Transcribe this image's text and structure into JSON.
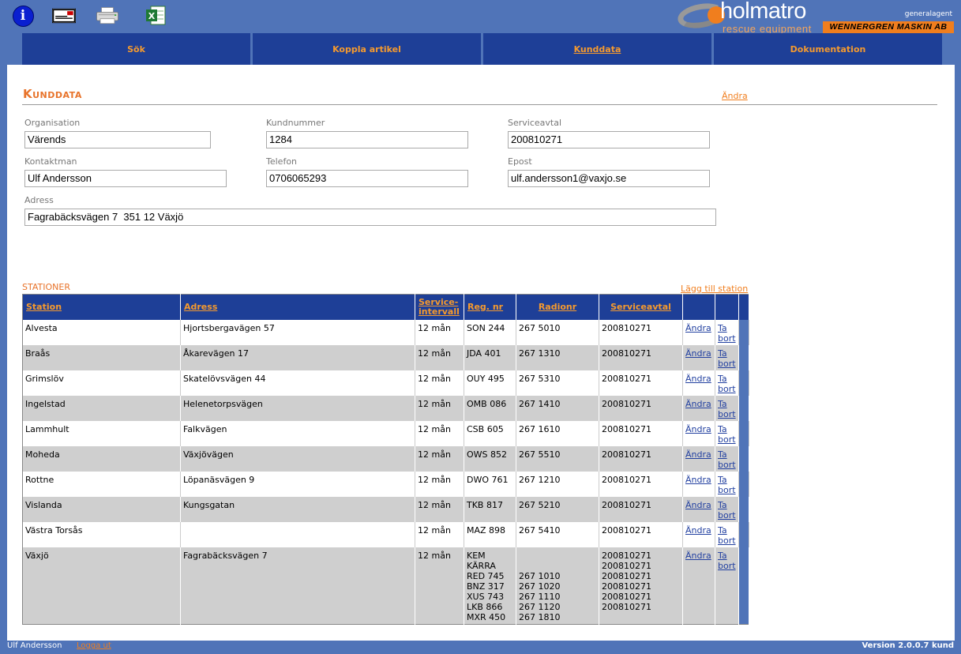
{
  "toolbar": {
    "icons": [
      "info-icon",
      "document-icon",
      "printer-icon",
      "excel-icon"
    ],
    "info_glyph": "i"
  },
  "logo": {
    "name": "holmatro",
    "tagline": "rescue equipment",
    "agent_label": "generalagent",
    "dealer": "WENNERGREN MASKIN AB"
  },
  "colors": {
    "background": "#5074b8",
    "nav": "#1e3f97",
    "accent": "#f07e1e",
    "row_alt": "#cfcfcf"
  },
  "nav": {
    "tabs": [
      {
        "label": "Sök"
      },
      {
        "label": "Koppla artikel"
      },
      {
        "label": "Kunddata"
      },
      {
        "label": "Dokumentation"
      }
    ],
    "active": "Kunddata"
  },
  "customer": {
    "title": "Kunddata",
    "edit_label": "Ändra",
    "fields": {
      "organisation": {
        "label": "Organisation",
        "value": "Värends"
      },
      "kundnummer": {
        "label": "Kundnummer",
        "value": "1284"
      },
      "serviceavtal": {
        "label": "Serviceavtal",
        "value": "200810271"
      },
      "kontaktman": {
        "label": "Kontaktman",
        "value": "Ulf Andersson"
      },
      "telefon": {
        "label": "Telefon",
        "value": "0706065293"
      },
      "epost": {
        "label": "Epost",
        "value": "ulf.andersson1@vaxjo.se"
      },
      "adress": {
        "label": "Adress",
        "value": "Fagrabäcksvägen 7  351 12 Växjö"
      }
    }
  },
  "stations": {
    "title": "STATIONER",
    "add_label": "Lägg till station",
    "edit_label": "Ändra",
    "delete_label": "Ta bort",
    "columns": [
      "Station",
      "Adress",
      "Service-intervall",
      "Reg. nr",
      "Radionr",
      "Serviceavtal"
    ],
    "rows": [
      {
        "station": "Alvesta",
        "adress": "Hjortsbergavägen 57",
        "intervall": "12 mån",
        "regnr": "SON 244",
        "radionr": "267 5010",
        "avtal": "200810271"
      },
      {
        "station": "Braås",
        "adress": "Åkarevägen 17",
        "intervall": "12 mån",
        "regnr": "JDA 401",
        "radionr": "267 1310",
        "avtal": "200810271"
      },
      {
        "station": "Grimslöv",
        "adress": "Skatelövsvägen 44",
        "intervall": "12 mån",
        "regnr": "OUY 495",
        "radionr": "267 5310",
        "avtal": "200810271"
      },
      {
        "station": "Ingelstad",
        "adress": "Helenetorpsvägen",
        "intervall": "12 mån",
        "regnr": "OMB 086",
        "radionr": "267 1410",
        "avtal": "200810271"
      },
      {
        "station": "Lammhult",
        "adress": "Falkvägen",
        "intervall": "12 mån",
        "regnr": "CSB 605",
        "radionr": "267 1610",
        "avtal": "200810271"
      },
      {
        "station": "Moheda",
        "adress": "Växjövägen",
        "intervall": "12 mån",
        "regnr": "OWS 852",
        "radionr": "267 5510",
        "avtal": "200810271"
      },
      {
        "station": "Rottne",
        "adress": "Löpanäsvägen 9",
        "intervall": "12 mån",
        "regnr": "DWO 761",
        "radionr": "267 1210",
        "avtal": "200810271"
      },
      {
        "station": "Vislanda",
        "adress": "Kungsgatan",
        "intervall": "12 mån",
        "regnr": "TKB 817",
        "radionr": "267 5210",
        "avtal": "200810271"
      },
      {
        "station": "Västra Torsås",
        "adress": "",
        "intervall": "12 mån",
        "regnr": "MAZ 898",
        "radionr": "267 5410",
        "avtal": "200810271"
      }
    ],
    "last_row": {
      "station": "Växjö",
      "adress": "Fagrabäcksvägen 7",
      "intervall": "12 mån",
      "regnr": [
        "KEM",
        "KÄRRA",
        "RED 745",
        "BNZ 317",
        "XUS 743",
        "LKB 866",
        "MXR 450"
      ],
      "radionr": [
        "",
        "",
        "267 1010",
        "267 1020",
        "267 1110",
        "267 1120",
        "267 1810"
      ],
      "avtal": [
        "200810271",
        "200810271",
        "200810271",
        "200810271",
        "200810271",
        "200810271"
      ]
    }
  },
  "footer": {
    "user": "Ulf Andersson",
    "logout": "Logga ut",
    "version": "Version 2.0.0.7 kund"
  }
}
